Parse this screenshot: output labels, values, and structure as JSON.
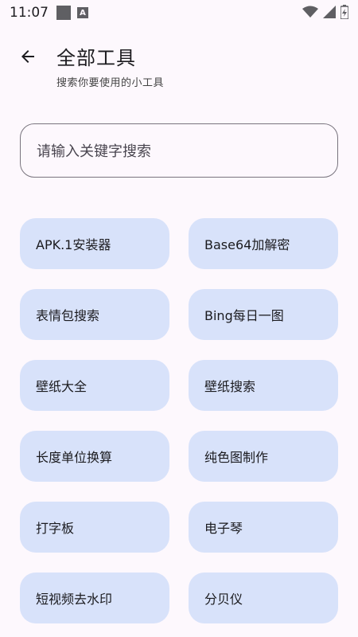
{
  "status_bar": {
    "time": "11:07",
    "notification_badge": "A"
  },
  "header": {
    "title": "全部工具",
    "subtitle": "搜索你要使用的小工具"
  },
  "search": {
    "placeholder": "请输入关键字搜索"
  },
  "tools": [
    {
      "label": "APK.1安装器"
    },
    {
      "label": "Base64加解密"
    },
    {
      "label": "表情包搜索"
    },
    {
      "label": "Bing每日一图"
    },
    {
      "label": "壁纸大全"
    },
    {
      "label": "壁纸搜索"
    },
    {
      "label": "长度单位换算"
    },
    {
      "label": "纯色图制作"
    },
    {
      "label": "打字板"
    },
    {
      "label": "电子琴"
    },
    {
      "label": "短视频去水印"
    },
    {
      "label": "分贝仪"
    }
  ],
  "colors": {
    "background": "#fdf8fd",
    "tool_button": "#d8e2fa",
    "outline": "#79747e"
  }
}
